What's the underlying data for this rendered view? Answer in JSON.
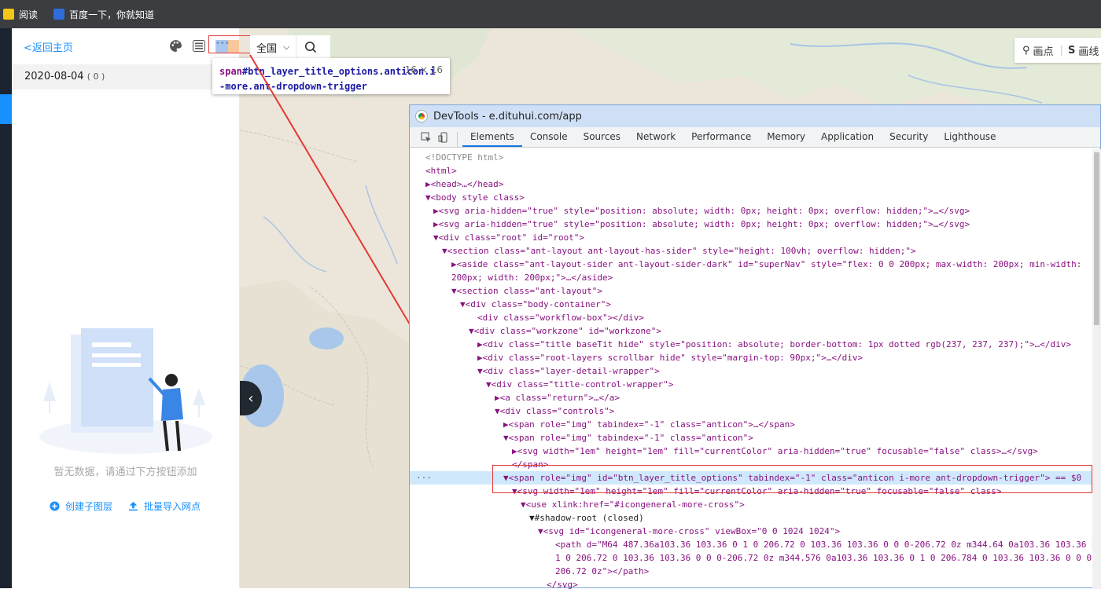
{
  "bookmarks": [
    {
      "label": "阅读"
    },
    {
      "label": "百度一下，你就知道"
    }
  ],
  "leftpanel": {
    "back": "<返回主页",
    "date": "2020-08-04",
    "count": "( 0 )",
    "empty_text": "暂无数据，请通过下方按钮添加",
    "create_layer": "创建子图层",
    "batch_import": "批量导入网点"
  },
  "region": {
    "label": "全国"
  },
  "tooltip": {
    "tag": "span",
    "selector1": "#btn_layer_title_options.anticon.i",
    "selector2": "-more.ant-dropdown-trigger",
    "size": "16 × 16"
  },
  "maptools": {
    "point": "画点",
    "line": "画线"
  },
  "devtools": {
    "title": "DevTools - e.dituhui.com/app",
    "tabs": [
      "Elements",
      "Console",
      "Sources",
      "Network",
      "Performance",
      "Memory",
      "Application",
      "Security",
      "Lighthouse"
    ],
    "lines": [
      "<!DOCTYPE html>",
      "<html>",
      "▶<head>…</head>",
      "▼<body style class>",
      "▶<svg aria-hidden=\"true\" style=\"position: absolute; width: 0px; height: 0px; overflow: hidden;\">…</svg>",
      "▶<svg aria-hidden=\"true\" style=\"position: absolute; width: 0px; height: 0px; overflow: hidden;\">…</svg>",
      "▼<div class=\"root\" id=\"root\">",
      "▼<section class=\"ant-layout ant-layout-has-sider\" style=\"height: 100vh; overflow: hidden;\">",
      "▶<aside class=\"ant-layout-sider ant-layout-sider-dark\" id=\"superNav\" style=\"flex: 0 0 200px; max-width: 200px; min-width:",
      "200px; width: 200px;\">…</aside>",
      "▼<section class=\"ant-layout\">",
      "▼<div class=\"body-container\">",
      "<div class=\"workflow-box\"></div>",
      "▼<div class=\"workzone\" id=\"workzone\">",
      "▶<div class=\"title baseTit  hide\" style=\"position: absolute; border-bottom: 1px dotted rgb(237, 237, 237);\">…</div>",
      "▶<div class=\"root-layers scrollbar hide\" style=\"margin-top: 90px;\">…</div>",
      "▼<div class=\"layer-detail-wrapper\">",
      "▼<div class=\"title-control-wrapper\">",
      "▶<a class=\"return\">…</a>",
      "▼<div class=\"controls\">",
      "▶<span role=\"img\" tabindex=\"-1\" class=\"anticon\">…</span>",
      "▼<span role=\"img\" tabindex=\"-1\" class=\"anticon\">",
      "▶<svg width=\"1em\" height=\"1em\" fill=\"currentColor\" aria-hidden=\"true\" focusable=\"false\" class>…</svg>",
      "</span>",
      "▼<span role=\"img\" id=\"btn_layer_title_options\" tabindex=\"-1\" class=\"anticon i-more ant-dropdown-trigger\"> == $0",
      "▼<svg width=\"1em\" height=\"1em\" fill=\"currentColor\" aria-hidden=\"true\" focusable=\"false\" class>",
      "▼<use xlink:href=\"#icongeneral-more-cross\">",
      "▼#shadow-root (closed)",
      "▼<svg id=\"icongeneral-more-cross\" viewBox=\"0 0 1024 1024\">",
      "<path d=\"M64 487.36a103.36 103.36 0 1 0 206.72 0 103.36 103.36 0 0 0-206.72 0z m344.64 0a103.36 103.36 0",
      "1 0 206.72 0 103.36 103.36 0 0 0-206.72 0z m344.576 0a103.36 103.36 0 1 0 206.784 0 103.36 103.36 0 0 0-",
      "206.72 0z\"></path>",
      "</svg>"
    ],
    "selected_dots": "···"
  }
}
